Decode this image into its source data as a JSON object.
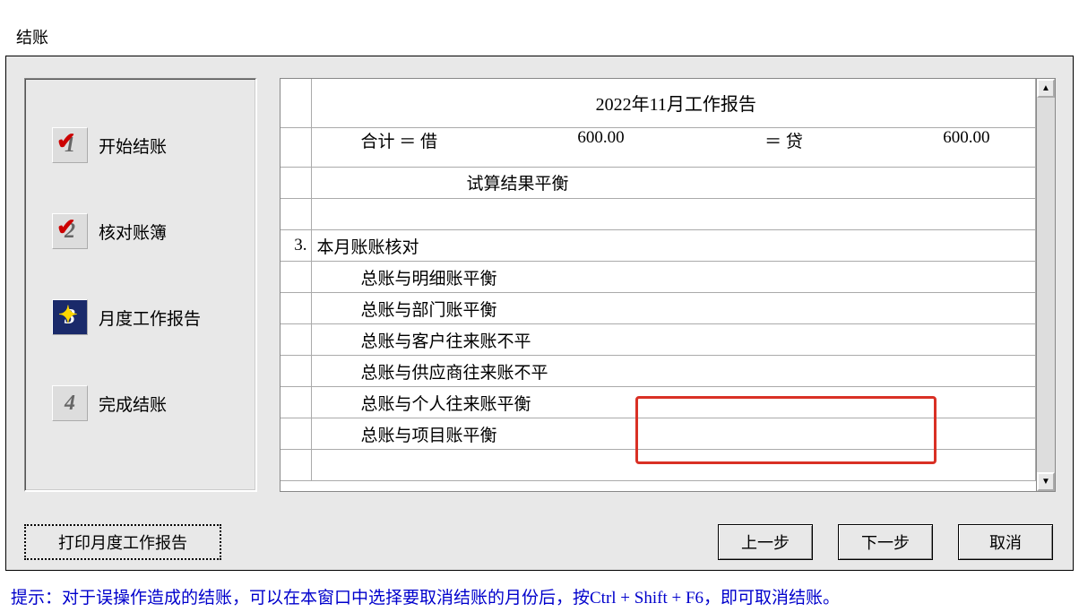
{
  "window": {
    "title": "结账"
  },
  "sidebar": {
    "items": [
      {
        "num": "1",
        "label": "开始结账"
      },
      {
        "num": "2",
        "label": "核对账簿"
      },
      {
        "num": "3",
        "label": "月度工作报告"
      },
      {
        "num": "4",
        "label": "完成结账"
      }
    ]
  },
  "report": {
    "header": "2022年11月工作报告",
    "totals": {
      "label_sum": "合计 ＝ 借",
      "debit": "600.00",
      "label_eq": "＝ 贷",
      "credit": "600.00"
    },
    "balance_result": "试算结果平衡",
    "section3": {
      "num": "3.",
      "title": "本月账账核对",
      "lines": [
        "总账与明细账平衡",
        "总账与部门账平衡",
        "总账与客户往来账不平",
        "总账与供应商往来账不平",
        "总账与个人往来账平衡",
        "总账与项目账平衡"
      ]
    }
  },
  "buttons": {
    "print": "打印月度工作报告",
    "prev": "上一步",
    "next": "下一步",
    "cancel": "取消"
  },
  "tip": "提示：对于误操作造成的结账，可以在本窗口中选择要取消结账的月份后，按Ctrl + Shift + F6，即可取消结账。"
}
